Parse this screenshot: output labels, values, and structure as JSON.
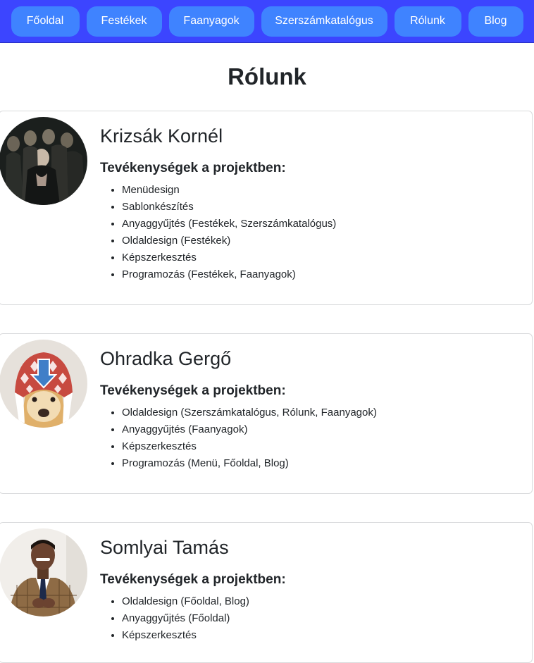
{
  "nav": {
    "items": [
      {
        "label": "Főoldal"
      },
      {
        "label": "Festékek"
      },
      {
        "label": "Faanyagok"
      },
      {
        "label": "Szerszámkatalógus"
      },
      {
        "label": "Rólunk"
      },
      {
        "label": "Blog"
      }
    ]
  },
  "page": {
    "title": "Rólunk"
  },
  "members": [
    {
      "name": "Krizsák Kornél",
      "activities_heading": "Tevékenységek a projektben:",
      "activities": [
        "Menüdesign",
        "Sablonkészítés",
        "Anyaggyűjtés (Festékek, Szerszámkatalógus)",
        "Oldaldesign (Festékek)",
        "Képszerkesztés",
        "Programozás (Festékek, Faanyagok)"
      ]
    },
    {
      "name": "Ohradka Gergő",
      "activities_heading": "Tevékenységek a projektben:",
      "activities": [
        "Oldaldesign (Szerszámkatalógus, Rólunk, Faanyagok)",
        "Anyaggyűjtés (Faanyagok)",
        "Képszerkesztés",
        "Programozás (Menü, Főoldal, Blog)"
      ]
    },
    {
      "name": "Somlyai Tamás",
      "activities_heading": "Tevékenységek a projektben:",
      "activities": [
        "Oldaldesign (Főoldal, Blog)",
        "Anyaggyűjtés (Főoldal)",
        "Képszerkesztés"
      ]
    }
  ],
  "colors": {
    "nav_bg": "#3c45ff",
    "nav_button": "#3f83ff",
    "card_border": "#d9dadc"
  }
}
